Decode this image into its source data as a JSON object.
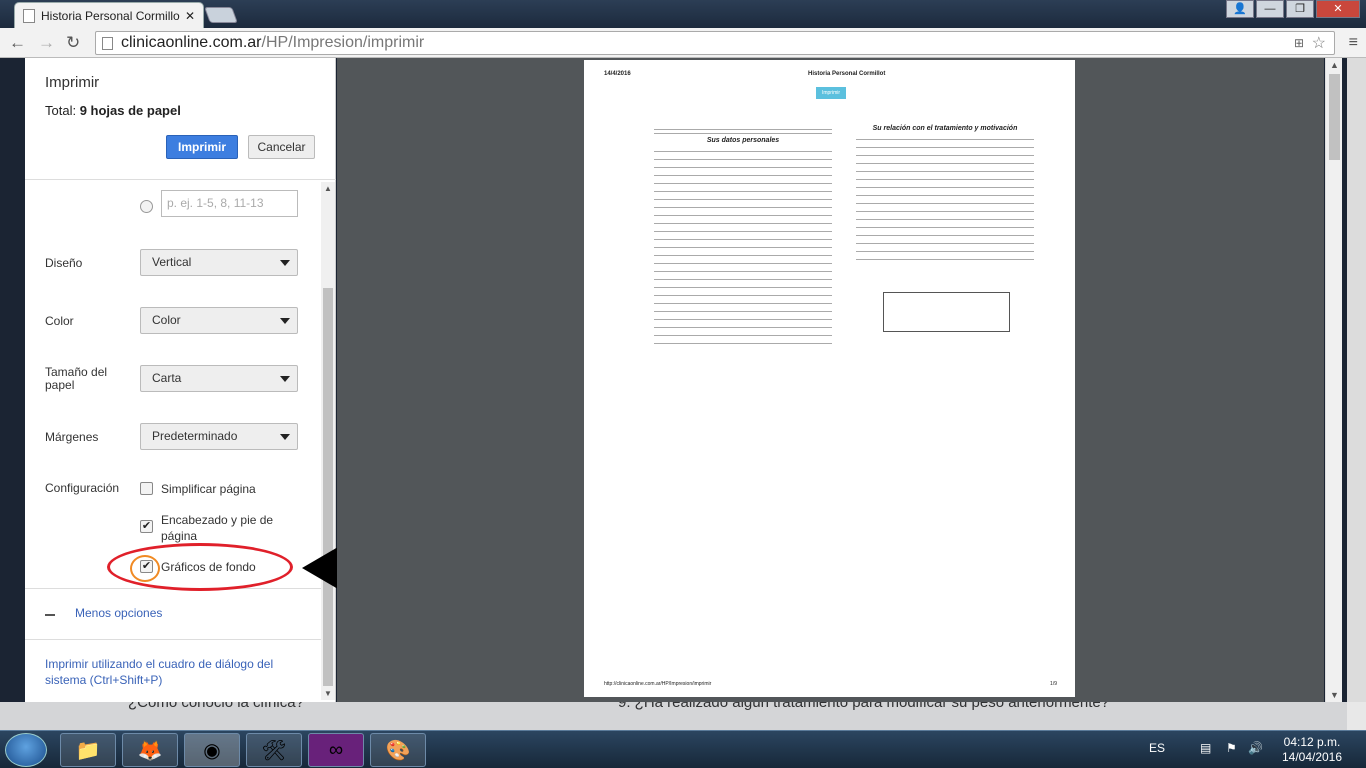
{
  "browser": {
    "tab_title": "Historia Personal Cormillo",
    "url_domain": "clinicaonline.com.ar",
    "url_path": "/HP/Impresion/imprimir"
  },
  "print": {
    "title": "Imprimir",
    "total_prefix": "Total: ",
    "total_value": "9 hojas de papel",
    "print_button": "Imprimir",
    "cancel_button": "Cancelar",
    "pages_placeholder": "p. ej. 1-5, 8, 11-13",
    "layout_label": "Diseño",
    "layout_value": "Vertical",
    "color_label": "Color",
    "color_value": "Color",
    "paper_label": "Tamaño del papel",
    "paper_value": "Carta",
    "margins_label": "Márgenes",
    "margins_value": "Predeterminado",
    "options_label": "Configuración",
    "opt_simplify": "Simplificar página",
    "opt_simplify_checked": false,
    "opt_headers": "Encabezado y pie de página",
    "opt_headers_checked": true,
    "opt_background": "Gráficos de fondo",
    "opt_background_checked": true,
    "less_options": "Menos opciones",
    "system_dialog": "Imprimir utilizando el cuadro de diálogo del sistema (Ctrl+Shift+P)"
  },
  "preview": {
    "date": "14/4/2016",
    "doc_title": "Historia Personal Cormillot",
    "button": "Imprimir",
    "left_section": "Sus datos personales",
    "right_section": "Su relación con el tratamiento y motivación",
    "footer_url": "http://clinicaonline.com.ar/HP/Impresion/imprimir",
    "page_num": "1/9"
  },
  "background_strip": {
    "left": "¿Cómo conoció la clínica?",
    "right": "9. ¿Ha realizado algún tratamiento para modificar su peso anteriormente?"
  },
  "taskbar": {
    "language": "ES",
    "time": "04:12 p.m.",
    "date": "14/04/2016"
  },
  "colors": {
    "accent": "#3d7ee0",
    "link": "#3a63b8",
    "highlight_ring": "#e0202a"
  }
}
